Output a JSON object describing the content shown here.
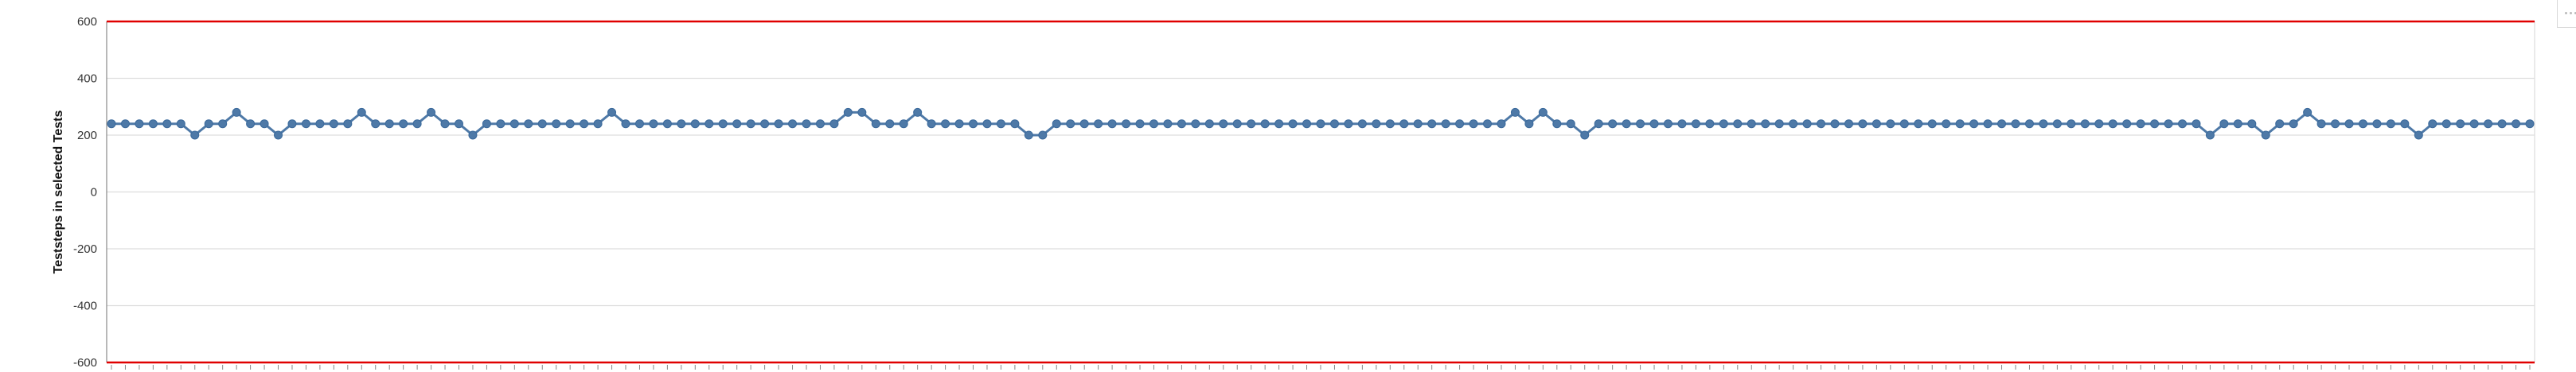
{
  "colors": {
    "line": "#4e79a7",
    "point": "#4e79a7",
    "limit": "#e00000",
    "grid": "#dddddd",
    "axis": "#888888"
  },
  "chart_data": {
    "type": "line",
    "title": "",
    "xlabel": "",
    "ylabel": "Teststeps in selected Tests",
    "ylim": [
      -600,
      600
    ],
    "yticks": [
      -600,
      -400,
      -200,
      0,
      200,
      400,
      600
    ],
    "ytick_labels": [
      "-600",
      "-400",
      "-200",
      "0",
      "200",
      "400",
      "600"
    ],
    "grid": true,
    "reference_lines": [
      {
        "y": 600,
        "color": "#e00000"
      },
      {
        "y": -600,
        "color": "#e00000"
      }
    ],
    "series": [
      {
        "values": [
          240,
          240,
          240,
          240,
          240,
          240,
          200,
          240,
          240,
          280,
          240,
          240,
          200,
          240,
          240,
          240,
          240,
          240,
          280,
          240,
          240,
          240,
          240,
          280,
          240,
          240,
          200,
          240,
          240,
          240,
          240,
          240,
          240,
          240,
          240,
          240,
          280,
          240,
          240,
          240,
          240,
          240,
          240,
          240,
          240,
          240,
          240,
          240,
          240,
          240,
          240,
          240,
          240,
          280,
          280,
          240,
          240,
          240,
          280,
          240,
          240,
          240,
          240,
          240,
          240,
          240,
          200,
          200,
          240,
          240,
          240,
          240,
          240,
          240,
          240,
          240,
          240,
          240,
          240,
          240,
          240,
          240,
          240,
          240,
          240,
          240,
          240,
          240,
          240,
          240,
          240,
          240,
          240,
          240,
          240,
          240,
          240,
          240,
          240,
          240,
          240,
          280,
          240,
          280,
          240,
          240,
          200,
          240,
          240,
          240,
          240,
          240,
          240,
          240,
          240,
          240,
          240,
          240,
          240,
          240,
          240,
          240,
          240,
          240,
          240,
          240,
          240,
          240,
          240,
          240,
          240,
          240,
          240,
          240,
          240,
          240,
          240,
          240,
          240,
          240,
          240,
          240,
          240,
          240,
          240,
          240,
          240,
          240,
          240,
          240,
          240,
          200,
          240,
          240,
          240,
          200,
          240,
          240,
          280,
          240,
          240,
          240,
          240,
          240,
          240,
          240,
          200,
          240,
          240,
          240,
          240,
          240,
          240,
          240,
          240
        ]
      }
    ]
  }
}
